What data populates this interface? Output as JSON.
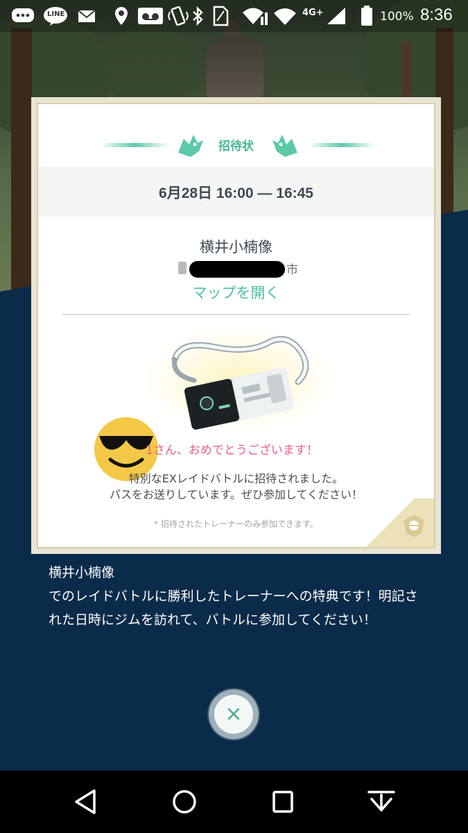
{
  "status_bar": {
    "line_label": "LINE",
    "network_label": "4G+",
    "battery_percent": "100%",
    "time": "8:36"
  },
  "invitation": {
    "title": "招待状",
    "date_time": "6月28日 16:00 — 16:45",
    "gym_name": "横井小楠像",
    "gym_city_suffix": "市",
    "open_map_label": "マップを開く",
    "congrats": "1さん、おめでとうございます！",
    "message_line1": "特別なEXレイドバトルに招待されました。",
    "message_line2": "パスをお送りしています。ぜひ参加してください！",
    "note": "* 招待されたトレーナーのみ参加できます。"
  },
  "description": {
    "title": "横井小楠像",
    "body": "でのレイドバトルに勝利したトレーナーへの特典です！明記された日時にジムを訪れて、バトルに参加してください！"
  },
  "close_button": {
    "label": "×"
  },
  "colors": {
    "accent_teal": "#4dbf9f",
    "congrats_pink": "#ea5f8a",
    "navy_background": "#0b2b4a"
  },
  "icons": {
    "status": [
      "chat-bubble-icon",
      "line-app-icon",
      "mail-icon",
      "location-pin-icon",
      "voicemail-icon",
      "vibrate-icon",
      "bluetooth-icon",
      "sim-icon",
      "wifi-signal-icon",
      "wifi-icon",
      "cell-signal-icon",
      "battery-icon"
    ],
    "nav": [
      "back-triangle-icon",
      "home-circle-icon",
      "recents-square-icon",
      "notification-pull-icon"
    ]
  }
}
